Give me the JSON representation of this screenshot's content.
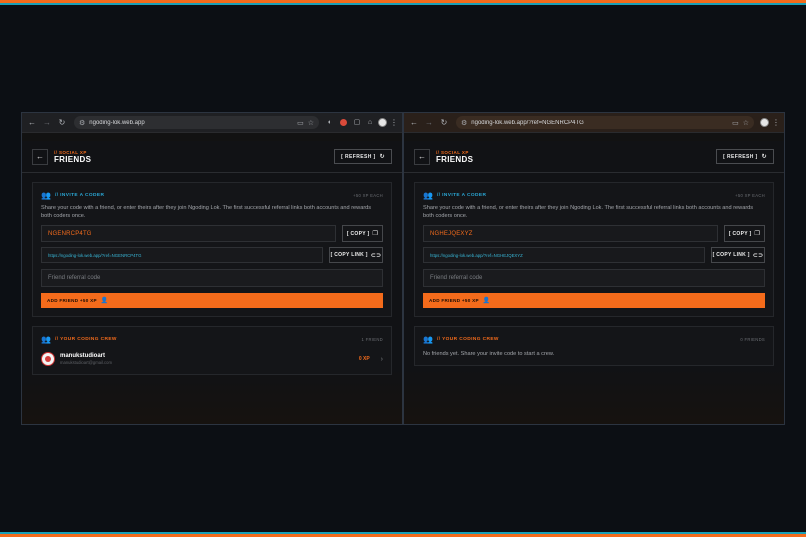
{
  "left": {
    "browser": {
      "url": "ngoding-lok.web.app"
    },
    "header": {
      "subtitle": "// SOCIAL XP",
      "title": "FRIENDS",
      "refresh_label": "[ REFRESH ]"
    },
    "invite": {
      "label": "// INVITE A CODER",
      "meta": "+50 XP EACH",
      "description": "Share your code with a friend, or enter theirs after they join Ngoding Lok. The first successful referral links both accounts and rewards both coders once.",
      "code": "NGENRCP4TG",
      "copy_label": "[ COPY ]",
      "link": "https://ngoding-lok.web.app/?ref=NGENRCP4TG",
      "copy_link_label": "[ COPY LINK ]",
      "referral_placeholder": "Friend referral code",
      "add_label": "ADD FRIEND +50 XP"
    },
    "crew": {
      "label": "// YOUR CODING CREW",
      "meta": "1 FRIEND",
      "friends": [
        {
          "name": "manukstudioart",
          "email": "manukstudioart@gmail.com",
          "xp": "0 XP"
        }
      ]
    }
  },
  "right": {
    "browser": {
      "url": "ngoding-lok.web.app/?ref=NGENRCP4TG"
    },
    "header": {
      "subtitle": "// SOCIAL XP",
      "title": "FRIENDS",
      "refresh_label": "[ REFRESH ]"
    },
    "invite": {
      "label": "// INVITE A CODER",
      "meta": "+50 XP EACH",
      "description": "Share your code with a friend, or enter theirs after they join Ngoding Lok. The first successful referral links both accounts and rewards both coders once.",
      "code": "NGHEJQEXYZ",
      "copy_label": "[ COPY ]",
      "link": "https://ngoding-lok.web.app/?ref=NGHEJQEXYZ",
      "copy_link_label": "[ COPY LINK ]",
      "referral_placeholder": "Friend referral code",
      "add_label": "ADD FRIEND +50 XP"
    },
    "crew": {
      "label": "// YOUR CODING CREW",
      "meta": "0 FRIENDS",
      "empty_text": "No friends yet. Share your invite code to start a crew."
    }
  },
  "colors": {
    "accent": "#f46b1b",
    "link": "#38b6d6",
    "background": "#0c0f14"
  }
}
